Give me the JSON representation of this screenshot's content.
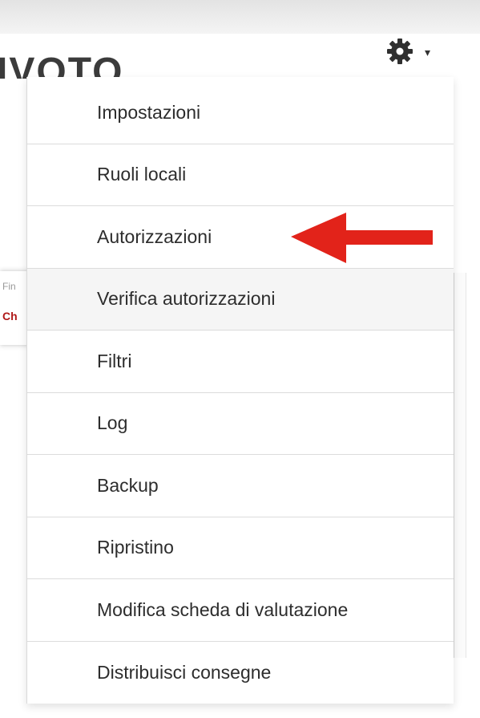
{
  "page": {
    "background_title": "IVOTO"
  },
  "bg_card": {
    "line1": "Fin",
    "line2": "Ch"
  },
  "settings": {
    "gear_icon": "gear-icon",
    "caret_icon": "caret-down-icon",
    "caret_glyph": "▾"
  },
  "menu": {
    "items": [
      {
        "label": "Impostazioni"
      },
      {
        "label": "Ruoli locali"
      },
      {
        "label": "Autorizzazioni"
      },
      {
        "label": "Verifica autorizzazioni"
      },
      {
        "label": "Filtri"
      },
      {
        "label": "Log"
      },
      {
        "label": "Backup"
      },
      {
        "label": "Ripristino"
      },
      {
        "label": "Modifica scheda di valutazione"
      },
      {
        "label": "Distribuisci consegne"
      }
    ],
    "highlighted_index": 3
  },
  "annotation": {
    "arrow_color": "#e2231a",
    "points_to": "Autorizzazioni"
  }
}
